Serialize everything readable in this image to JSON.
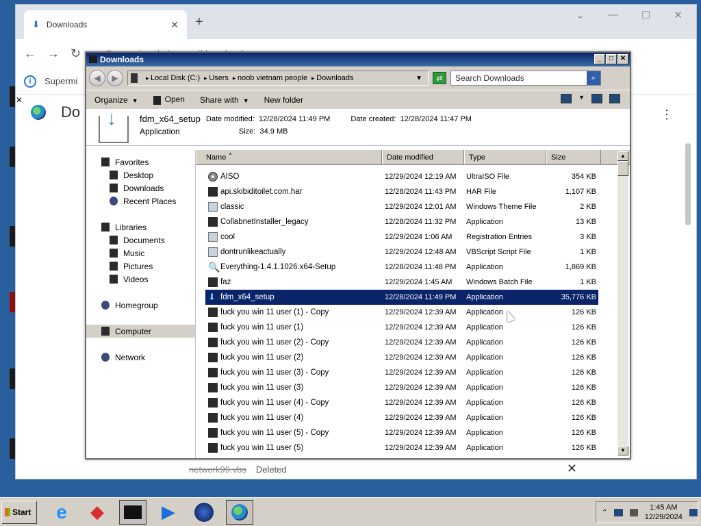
{
  "chrome": {
    "tab_title": "Downloads",
    "omnibox_prefix": "Supermium",
    "omnibox_url": "chrome://downloads",
    "infobar_text": "Supermi",
    "page_title": "Do",
    "deleted_item": {
      "filename": "network99.vbs",
      "status": "Deleted"
    }
  },
  "explorer": {
    "title": "Downloads",
    "breadcrumbs": [
      "Local Disk (C:)",
      "Users",
      "noob vietnam people",
      "Downloads"
    ],
    "search_placeholder": "Search Downloads",
    "toolbar": {
      "organize": "Organize",
      "open": "Open",
      "share": "Share with",
      "new_folder": "New folder"
    },
    "details": {
      "name": "fdm_x64_setup",
      "type": "Application",
      "modified_label": "Date modified:",
      "modified": "12/28/2024 11:49 PM",
      "created_label": "Date created:",
      "created": "12/28/2024 11:47 PM",
      "size_label": "Size:",
      "size": "34.9 MB"
    },
    "nav": {
      "favorites": "Favorites",
      "desktop": "Desktop",
      "downloads": "Downloads",
      "recent": "Recent Places",
      "libraries": "Libraries",
      "documents": "Documents",
      "music": "Music",
      "pictures": "Pictures",
      "videos": "Videos",
      "homegroup": "Homegroup",
      "computer": "Computer",
      "network": "Network"
    },
    "columns": {
      "name": "Name",
      "date": "Date modified",
      "type": "Type",
      "size": "Size"
    },
    "files": [
      {
        "name": "AISO",
        "date": "12/29/2024 12:19 AM",
        "type": "UltraISO File",
        "size": "354 KB",
        "icon": "disc"
      },
      {
        "name": "api.skibiditoilet.com.har",
        "date": "12/28/2024 11:43 PM",
        "type": "HAR File",
        "size": "1,107 KB",
        "icon": "dark"
      },
      {
        "name": "classic",
        "date": "12/29/2024 12:01 AM",
        "type": "Windows Theme File",
        "size": "2 KB",
        "icon": "light"
      },
      {
        "name": "CollabnetInstaller_legacy",
        "date": "12/28/2024 11:32 PM",
        "type": "Application",
        "size": "13 KB",
        "icon": "dark"
      },
      {
        "name": "cool",
        "date": "12/29/2024 1:06 AM",
        "type": "Registration Entries",
        "size": "3 KB",
        "icon": "light"
      },
      {
        "name": "dontrunlikeactually",
        "date": "12/29/2024 12:48 AM",
        "type": "VBScript Script File",
        "size": "1 KB",
        "icon": "light"
      },
      {
        "name": "Everything-1.4.1.1026.x64-Setup",
        "date": "12/28/2024 11:48 PM",
        "type": "Application",
        "size": "1,869 KB",
        "icon": "key"
      },
      {
        "name": "faz",
        "date": "12/29/2024 1:45 AM",
        "type": "Windows Batch File",
        "size": "1 KB",
        "icon": "dark"
      },
      {
        "name": "fdm_x64_setup",
        "date": "12/28/2024 11:49 PM",
        "type": "Application",
        "size": "35,776 KB",
        "icon": "dl",
        "selected": true
      },
      {
        "name": "fuck you win 11 user (1) - Copy",
        "date": "12/29/2024 12:39 AM",
        "type": "Application",
        "size": "126 KB",
        "icon": "dark"
      },
      {
        "name": "fuck you win 11 user (1)",
        "date": "12/29/2024 12:39 AM",
        "type": "Application",
        "size": "126 KB",
        "icon": "dark"
      },
      {
        "name": "fuck you win 11 user (2) - Copy",
        "date": "12/29/2024 12:39 AM",
        "type": "Application",
        "size": "126 KB",
        "icon": "dark"
      },
      {
        "name": "fuck you win 11 user (2)",
        "date": "12/29/2024 12:39 AM",
        "type": "Application",
        "size": "126 KB",
        "icon": "dark"
      },
      {
        "name": "fuck you win 11 user (3) - Copy",
        "date": "12/29/2024 12:39 AM",
        "type": "Application",
        "size": "126 KB",
        "icon": "dark"
      },
      {
        "name": "fuck you win 11 user (3)",
        "date": "12/29/2024 12:39 AM",
        "type": "Application",
        "size": "126 KB",
        "icon": "dark"
      },
      {
        "name": "fuck you win 11 user (4) - Copy",
        "date": "12/29/2024 12:39 AM",
        "type": "Application",
        "size": "126 KB",
        "icon": "dark"
      },
      {
        "name": "fuck you win 11 user (4)",
        "date": "12/29/2024 12:39 AM",
        "type": "Application",
        "size": "126 KB",
        "icon": "dark"
      },
      {
        "name": "fuck you win 11 user (5) - Copy",
        "date": "12/29/2024 12:39 AM",
        "type": "Application",
        "size": "126 KB",
        "icon": "dark"
      },
      {
        "name": "fuck you win 11 user (5)",
        "date": "12/29/2024 12:39 AM",
        "type": "Application",
        "size": "126 KB",
        "icon": "dark"
      }
    ]
  },
  "taskbar": {
    "start_label": "Start",
    "time": "1:45 AM",
    "date": "12/29/2024"
  },
  "colors": {
    "selection": "#0a246a",
    "titlebar": "#0a246a",
    "desktop": "#2a5f9e"
  }
}
